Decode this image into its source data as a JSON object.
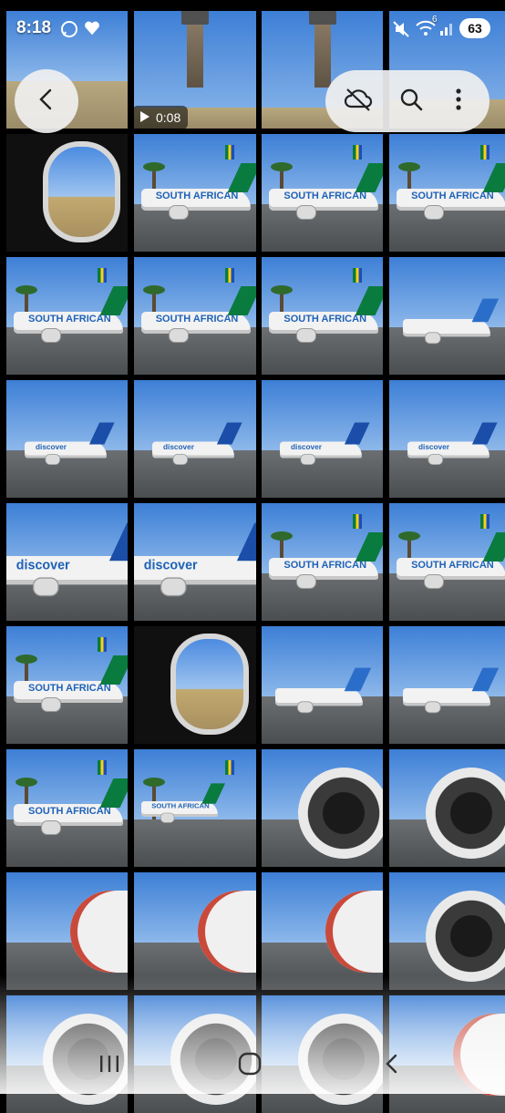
{
  "status_bar": {
    "time": "8:18",
    "battery": "63",
    "wifi_label": "6"
  },
  "video": {
    "duration": "0:08"
  },
  "tiles": [
    {
      "kind": "runway"
    },
    {
      "kind": "tower"
    },
    {
      "kind": "tower"
    },
    {
      "kind": "sky"
    },
    {
      "kind": "window"
    },
    {
      "kind": "sa-front"
    },
    {
      "kind": "sa-front"
    },
    {
      "kind": "sa-front"
    },
    {
      "kind": "sa-front"
    },
    {
      "kind": "sa-front"
    },
    {
      "kind": "sa-front"
    },
    {
      "kind": "small-plane"
    },
    {
      "kind": "discover-far"
    },
    {
      "kind": "discover-far"
    },
    {
      "kind": "discover-far"
    },
    {
      "kind": "discover-far"
    },
    {
      "kind": "discover-big"
    },
    {
      "kind": "discover-big"
    },
    {
      "kind": "sa-side"
    },
    {
      "kind": "sa-side"
    },
    {
      "kind": "sa-side"
    },
    {
      "kind": "window-2"
    },
    {
      "kind": "tails"
    },
    {
      "kind": "front-close"
    },
    {
      "kind": "sa-side"
    },
    {
      "kind": "sa-far"
    },
    {
      "kind": "engine"
    },
    {
      "kind": "engine"
    },
    {
      "kind": "eth-nose"
    },
    {
      "kind": "eth-nose"
    },
    {
      "kind": "eth-nose"
    },
    {
      "kind": "engine"
    },
    {
      "kind": "engine"
    },
    {
      "kind": "engine"
    },
    {
      "kind": "engine"
    },
    {
      "kind": "eth-nose"
    }
  ],
  "labels": {
    "discover": "discover",
    "south_african": "SOUTH AFRICAN"
  }
}
